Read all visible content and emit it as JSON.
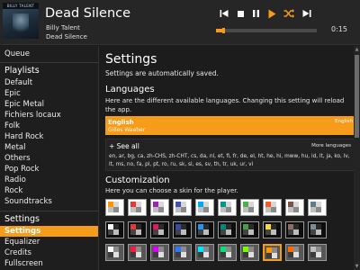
{
  "now_playing": {
    "title": "Dead Silence",
    "artist": "Billy Talent",
    "album": "Dead Silence",
    "art_band_text": "BILLY TALENT",
    "elapsed": "0:15",
    "progress_fraction": 0.07
  },
  "transport": {
    "buttons": [
      {
        "name": "previous-button",
        "icon": "previous-icon"
      },
      {
        "name": "stop-button",
        "icon": "stop-icon"
      },
      {
        "name": "pause-button",
        "icon": "pause-icon"
      },
      {
        "name": "play-button",
        "icon": "play-icon"
      },
      {
        "name": "shuffle-button",
        "icon": "shuffle-icon"
      },
      {
        "name": "next-button",
        "icon": "next-icon"
      }
    ],
    "icon_color": "#ffffff",
    "accent_color": "#f59c1a"
  },
  "sidebar": {
    "queue": "Queue",
    "playlists_header": "Playlists",
    "playlists": [
      "Default",
      "Epic",
      "Epic Metal",
      "Fichiers locaux",
      "Folk",
      "Hard Rock",
      "Metal",
      "Others",
      "Pop Rock",
      "Radio",
      "Rock",
      "Soundtracks"
    ],
    "settings_header": "Settings",
    "settings_items": [
      "Settings",
      "Equalizer",
      "Credits",
      "Fullscreen"
    ],
    "active_item": "Settings"
  },
  "settings": {
    "title": "Settings",
    "subtitle": "Settings are automatically saved.",
    "languages": {
      "header": "Languages",
      "description": "Here are the different available languages. Changing this setting will reload the app.",
      "selected_name": "English",
      "selected_translator": "Gilles Waeber",
      "selected_tag": "English",
      "see_all": "+ See all",
      "more_languages": "More languages",
      "codes": "en, ar, bg, ca, zh-CHS, zh-CHT, cs, da, nl, et, fi, fr, de, el, ht, he, hi, mww, hu, id, it, ja, ko, lv, lt, ms, no, fa, pl, pt, ro, ru, sk, sl, es, sv, th, tr, uk, ur, vi"
    },
    "customization": {
      "header": "Customization",
      "description": "Here you can choose a skin for the player.",
      "skins": [
        {
          "bg": "light",
          "accent": "#ff9800",
          "selected": false
        },
        {
          "bg": "light",
          "accent": "#e53935",
          "selected": false
        },
        {
          "bg": "light",
          "accent": "#9c27b0",
          "selected": false
        },
        {
          "bg": "light",
          "accent": "#3f51b5",
          "selected": false
        },
        {
          "bg": "light",
          "accent": "#03a9f4",
          "selected": false
        },
        {
          "bg": "light",
          "accent": "#009688",
          "selected": false
        },
        {
          "bg": "light",
          "accent": "#4caf50",
          "selected": false
        },
        {
          "bg": "light",
          "accent": "#ff5722",
          "selected": false
        },
        {
          "bg": "light",
          "accent": "#795548",
          "selected": false
        },
        {
          "bg": "light",
          "accent": "#607d8b",
          "selected": false
        },
        {
          "bg": "dark",
          "accent": "#ffffff",
          "selected": false
        },
        {
          "bg": "dark",
          "accent": "#e53935",
          "selected": false
        },
        {
          "bg": "dark",
          "accent": "#d81b60",
          "selected": false
        },
        {
          "bg": "dark",
          "accent": "#3949ab",
          "selected": false
        },
        {
          "bg": "dark",
          "accent": "#2196f3",
          "selected": false
        },
        {
          "bg": "dark",
          "accent": "#00897b",
          "selected": false
        },
        {
          "bg": "dark",
          "accent": "#43a047",
          "selected": false
        },
        {
          "bg": "dark",
          "accent": "#fdd835",
          "selected": false
        },
        {
          "bg": "dark",
          "accent": "#8d6e63",
          "selected": false
        },
        {
          "bg": "dark",
          "accent": "#78909c",
          "selected": false
        },
        {
          "bg": "grey",
          "accent": "#ffffff",
          "selected": false
        },
        {
          "bg": "grey",
          "accent": "#ff1744",
          "selected": false
        },
        {
          "bg": "grey",
          "accent": "#d500f9",
          "selected": false
        },
        {
          "bg": "grey",
          "accent": "#2979ff",
          "selected": false
        },
        {
          "bg": "grey",
          "accent": "#00e5ff",
          "selected": false
        },
        {
          "bg": "grey",
          "accent": "#00e676",
          "selected": false
        },
        {
          "bg": "grey",
          "accent": "#76ff03",
          "selected": false
        },
        {
          "bg": "grey",
          "accent": "#ff9800",
          "selected": true
        },
        {
          "bg": "grey",
          "accent": "#ff6d00",
          "selected": false
        },
        {
          "bg": "grey",
          "accent": "#bdbdbd",
          "selected": false
        }
      ]
    }
  }
}
